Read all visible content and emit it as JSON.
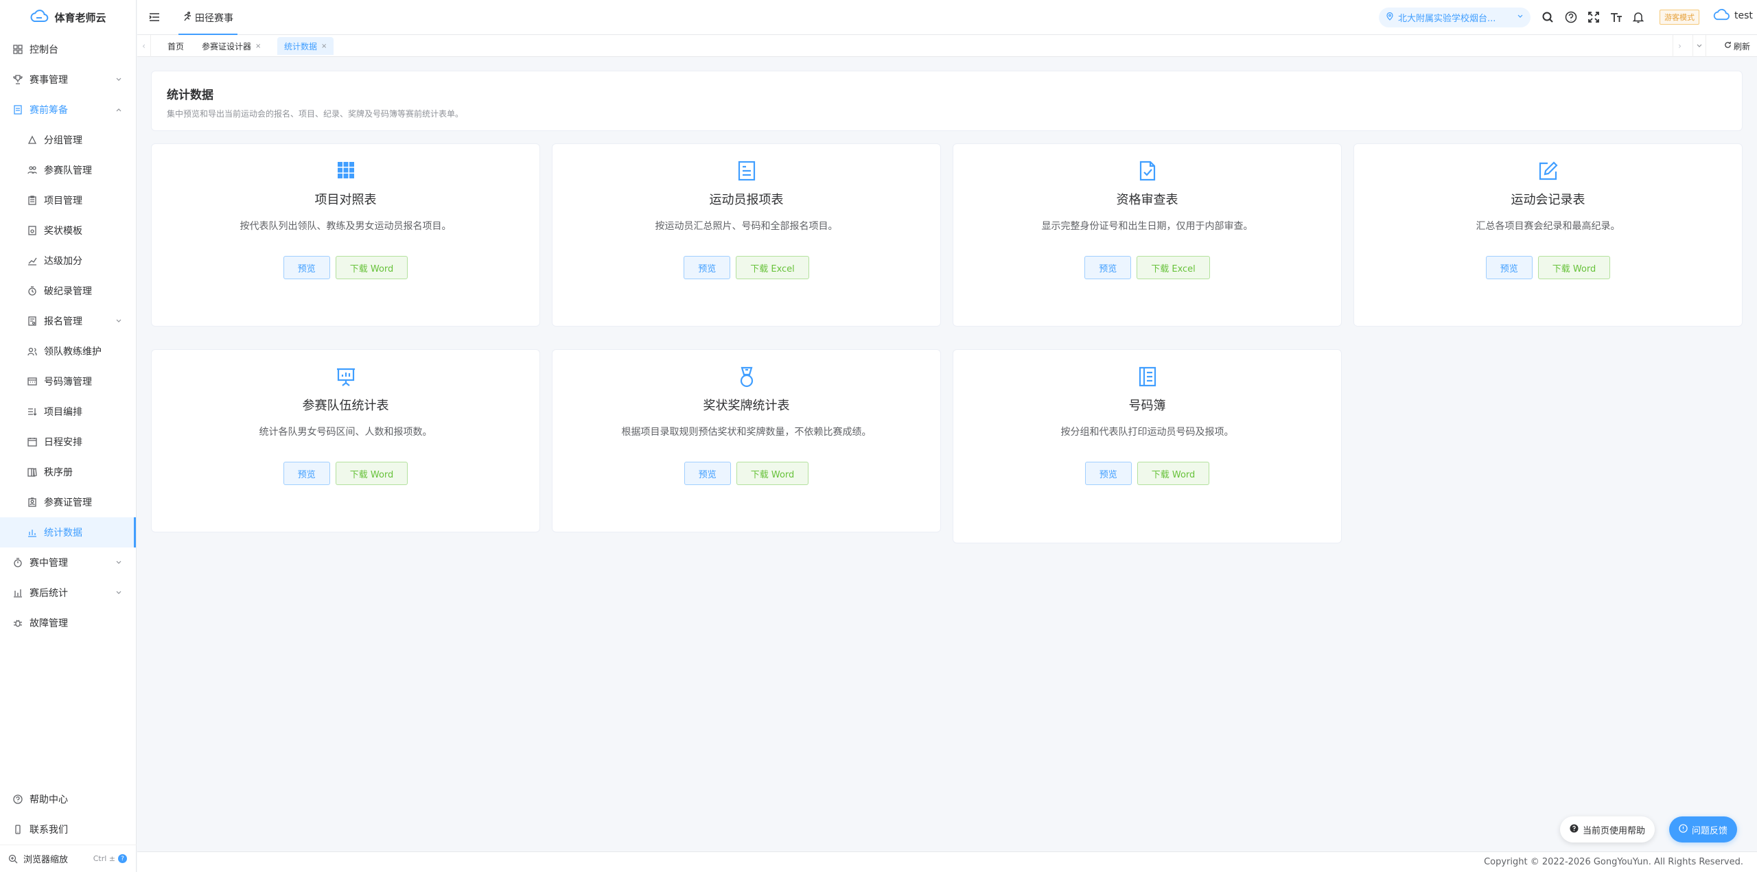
{
  "app": {
    "brand": "体育老师云"
  },
  "sidebar": {
    "items": [
      {
        "label": "控制台",
        "icon": "dashboard-icon"
      },
      {
        "label": "赛事管理",
        "icon": "trophy-icon"
      },
      {
        "label": "赛前筹备",
        "icon": "doc-icon"
      },
      {
        "label": "分组管理",
        "icon": "group-icon"
      },
      {
        "label": "参赛队管理",
        "icon": "team-icon"
      },
      {
        "label": "项目管理",
        "icon": "clipboard-icon"
      },
      {
        "label": "奖状模板",
        "icon": "certificate-icon"
      },
      {
        "label": "达级加分",
        "icon": "chart-up-icon"
      },
      {
        "label": "破纪录管理",
        "icon": "record-icon"
      },
      {
        "label": "报名管理",
        "icon": "signup-icon"
      },
      {
        "label": "领队教练维护",
        "icon": "coach-icon"
      },
      {
        "label": "号码簿管理",
        "icon": "bib-icon"
      },
      {
        "label": "项目编排",
        "icon": "arrange-icon"
      },
      {
        "label": "日程安排",
        "icon": "calendar-icon"
      },
      {
        "label": "秩序册",
        "icon": "book-icon"
      },
      {
        "label": "参赛证管理",
        "icon": "badge-icon"
      },
      {
        "label": "统计数据",
        "icon": "stats-icon"
      },
      {
        "label": "赛中管理",
        "icon": "timer-icon"
      },
      {
        "label": "赛后统计",
        "icon": "bar-chart-icon"
      },
      {
        "label": "故障管理",
        "icon": "bug-icon"
      }
    ],
    "bottom": {
      "help": "帮助中心",
      "contact": "联系我们",
      "zoom": "浏览器缩放",
      "zoom_hint": "Ctrl ±"
    }
  },
  "header": {
    "top_tab": "田径赛事",
    "school": "北大附属实验学校烟台...",
    "guest_mode": "游客模式",
    "user": "test"
  },
  "tabs": {
    "items": [
      "首页",
      "参赛证设计器",
      "统计数据"
    ],
    "refresh": "刷新"
  },
  "intro": {
    "title": "统计数据",
    "desc": "集中预览和导出当前运动会的报名、项目、纪录、奖牌及号码簿等赛前统计表单。"
  },
  "cards": [
    {
      "title": "项目对照表",
      "desc": "按代表队列出领队、教练及男女运动员报名项目。",
      "preview": "预览",
      "download": "下载 Word",
      "icon": "grid-icon"
    },
    {
      "title": "运动员报项表",
      "desc": "按运动员汇总照片、号码和全部报名项目。",
      "preview": "预览",
      "download": "下载 Excel",
      "icon": "document-list-icon"
    },
    {
      "title": "资格审查表",
      "desc": "显示完整身份证号和出生日期，仅用于内部审查。",
      "preview": "预览",
      "download": "下载 Excel",
      "icon": "file-check-icon"
    },
    {
      "title": "运动会记录表",
      "desc": "汇总各项目赛会纪录和最高纪录。",
      "preview": "预览",
      "download": "下载 Word",
      "icon": "edit-icon"
    },
    {
      "title": "参赛队伍统计表",
      "desc": "统计各队男女号码区间、人数和报项数。",
      "preview": "预览",
      "download": "下载 Word",
      "icon": "presentation-icon"
    },
    {
      "title": "奖状奖牌统计表",
      "desc": "根据项目录取规则预估奖状和奖牌数量，不依赖比赛成绩。",
      "preview": "预览",
      "download": "下载 Word",
      "icon": "medal-icon"
    },
    {
      "title": "号码簿",
      "desc": "按分组和代表队打印运动员号码及报项。",
      "preview": "预览",
      "download": "下载 Word",
      "icon": "notebook-icon"
    }
  ],
  "footer": {
    "copyright": "Copyright © 2022-2026 GongYouYun. All Rights Reserved.",
    "help_btn": "当前页使用帮助",
    "feedback_btn": "问题反馈"
  },
  "colors": {
    "primary": "#409eff",
    "success": "#67c23a",
    "warning": "#e6a23c"
  }
}
